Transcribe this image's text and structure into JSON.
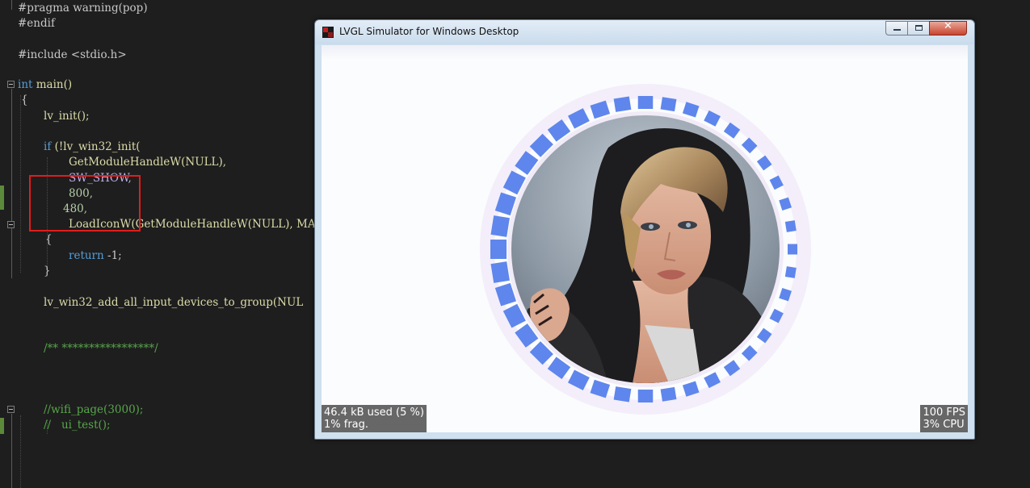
{
  "editor": {
    "lines": [
      {
        "id": "l1",
        "text": "#pragma warning(pop)"
      },
      {
        "id": "l2",
        "text": "#endif"
      },
      {
        "id": "l3",
        "text": "#include <stdio.h>"
      },
      {
        "id": "l4_kw",
        "text": "int"
      },
      {
        "id": "l4_fn",
        "text": " main()"
      },
      {
        "id": "l5",
        "text": "{"
      },
      {
        "id": "l6",
        "text": "lv_init();"
      },
      {
        "id": "l7_kw",
        "text": "if"
      },
      {
        "id": "l7_rest",
        "text": " (!lv_win32_init("
      },
      {
        "id": "l8",
        "text": "GetModuleHandleW(NULL),"
      },
      {
        "id": "l9",
        "text": "SW_SHOW,"
      },
      {
        "id": "l10",
        "text": "800,"
      },
      {
        "id": "l11",
        "text": "480,"
      },
      {
        "id": "l12",
        "text": "LoadIconW(GetModuleHandleW(NULL), MAKEI"
      },
      {
        "id": "l13",
        "text": "{"
      },
      {
        "id": "l14_kw",
        "text": "return"
      },
      {
        "id": "l14_rest",
        "text": " -1;"
      },
      {
        "id": "l15",
        "text": "}"
      },
      {
        "id": "l16",
        "text": "lv_win32_add_all_input_devices_to_group(NUL"
      },
      {
        "id": "l17",
        "text": "/** *****************/"
      },
      {
        "id": "l18",
        "text": "//wifi_page(3000);"
      },
      {
        "id": "l19",
        "text": "//   ui_test();"
      }
    ]
  },
  "window": {
    "title": "LVGL Simulator for Windows Desktop",
    "close_glyph": "✕"
  },
  "simulator": {
    "mem_stats": "46.4 kB used (5 %)\n1% frag.",
    "perf_stats": "100 FPS\n3% CPU",
    "ring": {
      "segments": 40,
      "color": "#5f86ec",
      "glow_color": "#f3eefa"
    }
  },
  "colors": {
    "editor_bg": "#1e1e1e",
    "highlight_box": "#e21c1c"
  }
}
